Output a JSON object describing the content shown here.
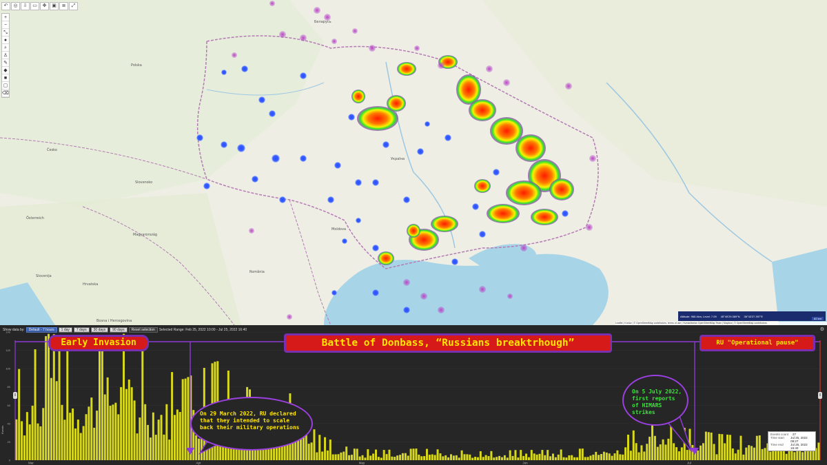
{
  "map": {
    "country_labels": [
      "Беларусь",
      "Україна",
      "Polska",
      "Česko",
      "Slovensko",
      "Magyarország",
      "România",
      "Moldova",
      "Österreich",
      "Slovenija",
      "Hrvatska",
      "Bosna i Hercegovina"
    ],
    "toolbar_top_icons": [
      "undo-icon",
      "record-icon",
      "download-icon",
      "camera-icon",
      "move-icon",
      "image-icon",
      "layers-icon",
      "fullscreen-icon"
    ],
    "toolbar_left_icons": [
      "zoom-in-icon",
      "zoom-out-icon",
      "fit-icon",
      "locate-icon",
      "search-icon",
      "person-icon",
      "pencil-icon",
      "eraser-icon",
      "square-icon",
      "delete-icon",
      "trash-icon"
    ],
    "status": {
      "altitude": "Altitude: 965.4km, Level: 7.09",
      "coord_1": "45°45'29.369\"N",
      "coord_2": "36°43'27.397\"E",
      "zoom": "82 km"
    },
    "attribution": "Leaflet | Kontur | © OpenStreetMap contributors, terms of use | Humanitarian OpenStreetMap Team | Mapbox | © OpenStreetMap contributors"
  },
  "timeline": {
    "filter": {
      "label": "Show data by:",
      "options": [
        "Default - 7 hours",
        "1 day",
        "7 days",
        "30 days",
        "90 days"
      ],
      "reset": "Reset selection",
      "range": "Selected Range: Feb 25, 2022 10:00 - Jul 25, 2022 16:40"
    },
    "banners": {
      "early": "Early Invasion",
      "donbass": "Battle of Donbass, “Russians breaktrhough”",
      "pause": "RU \"Operational pause\""
    },
    "callouts": {
      "march": "On 29 March 2022, RU declared that they intended to scale back their military operations",
      "july": "On 5 July 2022, first reports of HIMARS strikes"
    },
    "tooltip": {
      "rows": [
        {
          "k": "Events count",
          "v": "27"
        },
        {
          "k": "Time start",
          "v": "Jul 25, 2022 09:27"
        },
        {
          "k": "Time end",
          "v": "Jul 25, 2022 16:40"
        }
      ]
    },
    "y_axis_label": "Events",
    "colors": {
      "bars": "#d8d81c",
      "markers": "#8e3ad6",
      "banner_fill": "#d61919",
      "banner_text": "#ffe600"
    }
  },
  "chart_data": {
    "type": "bar",
    "ylabel": "Events",
    "ylim": [
      0,
      140
    ],
    "yticks": [
      0,
      20,
      40,
      60,
      80,
      100,
      120,
      140
    ],
    "xticks": [
      "Mar",
      "Apr",
      "May",
      "Jun",
      "Jul"
    ],
    "x_range": [
      "Feb 25, 2022",
      "Jul 25, 2022"
    ],
    "series": [
      {
        "values": [
          60,
          88,
          72,
          95,
          70,
          55,
          68,
          48,
          52,
          18,
          8,
          7,
          8,
          7,
          6,
          7,
          7,
          8,
          12,
          30,
          22,
          18,
          16,
          20,
          12
        ]
      }
    ],
    "markers": [
      "Mar 29, 2022",
      "Jul 5, 2022"
    ]
  }
}
